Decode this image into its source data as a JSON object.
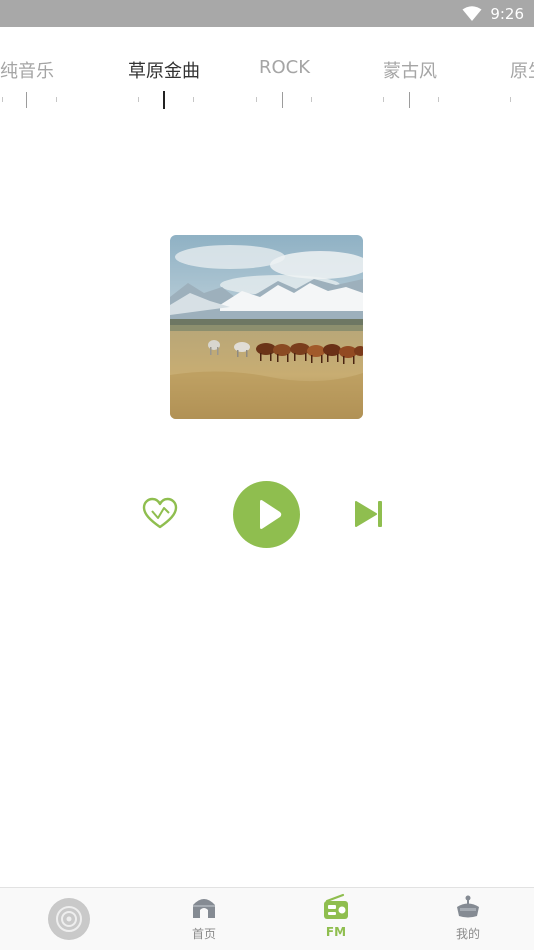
{
  "status_bar": {
    "time": "9:26",
    "icons": [
      "wifi-icon"
    ]
  },
  "channel_tabs": {
    "items": [
      {
        "label": "纯音乐",
        "active": false
      },
      {
        "label": "草原金曲",
        "active": true
      },
      {
        "label": "ROCK",
        "active": false
      },
      {
        "label": "蒙古风",
        "active": false
      },
      {
        "label": "原生",
        "active": false
      }
    ]
  },
  "player": {
    "album_art": "horses-on-grassland-mountains",
    "controls": [
      "heart-icon",
      "play-icon",
      "skip-next-icon"
    ]
  },
  "bottom_nav": {
    "now_playing_icon": "disc-icon",
    "items": [
      {
        "label": "首页",
        "icon": "home-icon",
        "active": false
      },
      {
        "label": "FM",
        "icon": "radio-icon",
        "active": true
      },
      {
        "label": "我的",
        "icon": "profile-icon",
        "active": false
      }
    ]
  },
  "colors": {
    "accent": "#8fbe4f",
    "status_bar": "#a8a8a8",
    "tab_inactive": "#a5a5a5",
    "tab_active": "#333333",
    "nav_inactive": "#8a8a8a"
  }
}
